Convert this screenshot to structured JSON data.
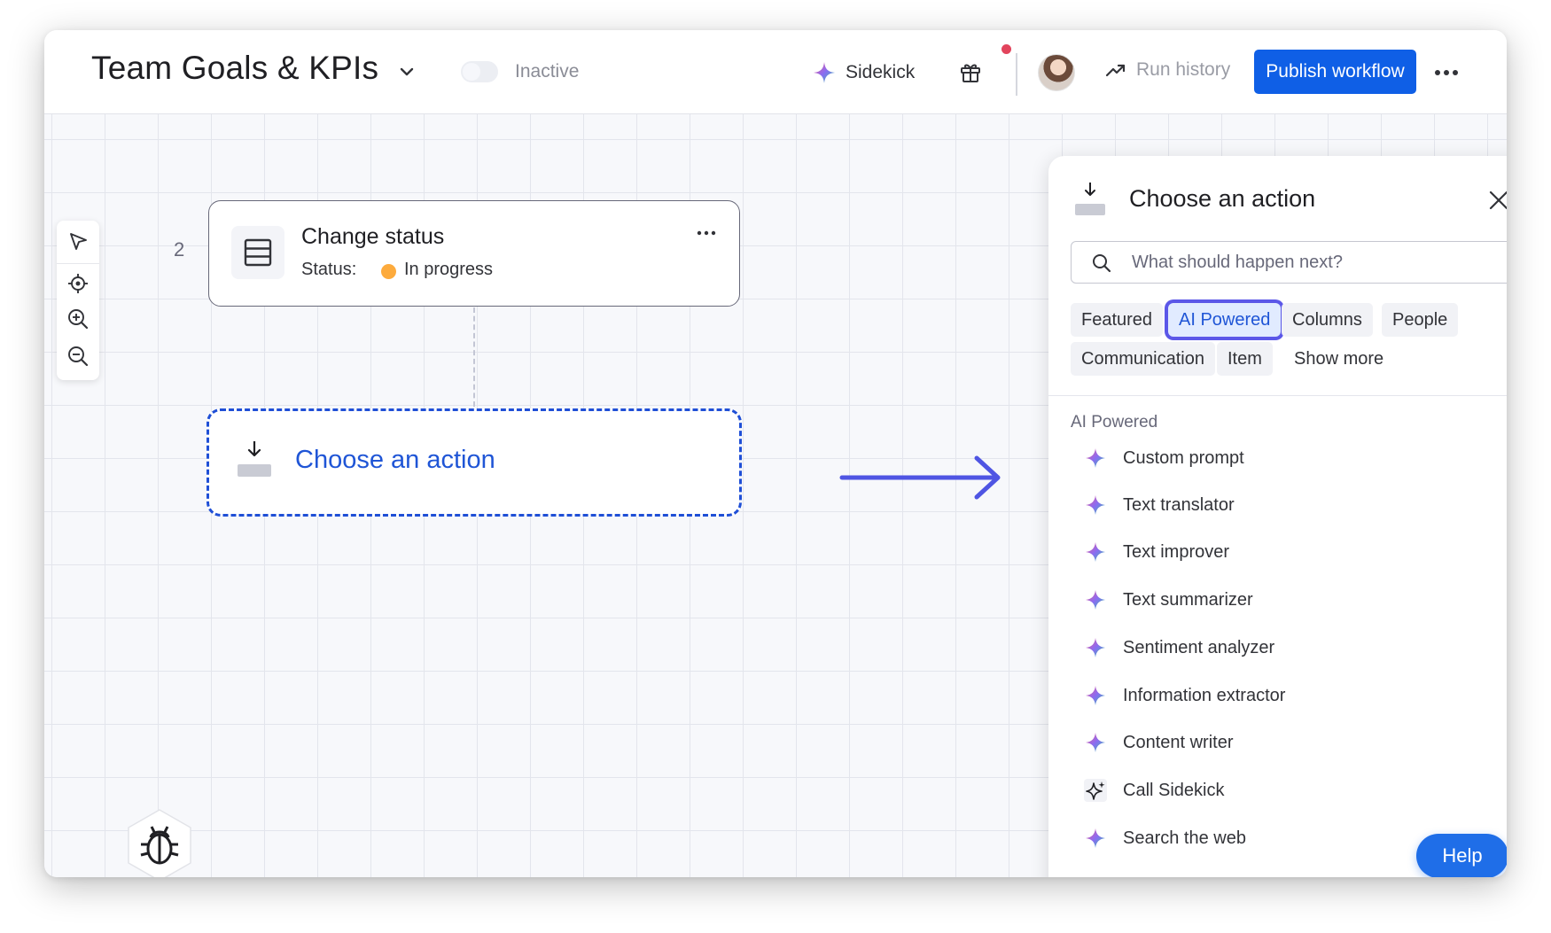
{
  "header": {
    "title": "Team Goals & KPIs",
    "toggle_label": "Inactive",
    "sidekick_label": "Sidekick",
    "run_history_label": "Run history",
    "publish_label": "Publish workflow"
  },
  "canvas": {
    "step_number": "2",
    "status_card": {
      "title": "Change status",
      "status_key": "Status:",
      "status_value": "In progress",
      "status_color": "#fdab3d"
    },
    "action_card": {
      "label": "Choose an action"
    },
    "toolbar": [
      "select-icon",
      "recenter-icon",
      "zoom-in-icon",
      "zoom-out-icon"
    ]
  },
  "panel": {
    "title": "Choose an action",
    "search_placeholder": "What should happen next?",
    "chips": [
      "Featured",
      "AI Powered",
      "Columns",
      "People",
      "Communication",
      "Item",
      "Show more"
    ],
    "active_chip": "AI Powered",
    "section_label": "AI Powered",
    "items": [
      {
        "label": "Custom prompt",
        "icon": "ai-sparkle-icon"
      },
      {
        "label": "Text translator",
        "icon": "ai-sparkle-icon"
      },
      {
        "label": "Text improver",
        "icon": "ai-sparkle-icon"
      },
      {
        "label": "Text summarizer",
        "icon": "ai-sparkle-icon"
      },
      {
        "label": "Sentiment analyzer",
        "icon": "ai-sparkle-icon"
      },
      {
        "label": "Information extractor",
        "icon": "ai-sparkle-icon"
      },
      {
        "label": "Content writer",
        "icon": "ai-sparkle-icon"
      },
      {
        "label": "Call Sidekick",
        "icon": "sidekick-outline-icon"
      },
      {
        "label": "Search the web",
        "icon": "ai-sparkle-icon"
      }
    ],
    "help_label": "Help"
  },
  "colors": {
    "accent": "#0f5fe6",
    "action_blue": "#1f55d6",
    "active_outline": "#5b57e8",
    "notification": "#e2445c"
  }
}
